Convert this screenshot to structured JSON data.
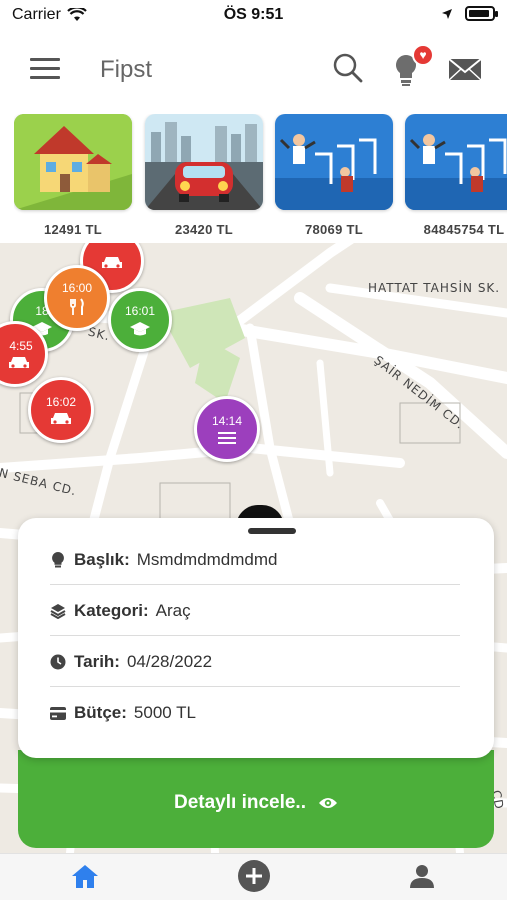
{
  "status": {
    "carrier": "Carrier",
    "time": "ÖS 9:51",
    "battery_level": 0.92
  },
  "header": {
    "title": "Fipst",
    "notification_badge": "♥"
  },
  "thumbnails": [
    {
      "icon": "house-illustration",
      "price": "12491 TL"
    },
    {
      "icon": "car-illustration",
      "price": "23420 TL"
    },
    {
      "icon": "hurdle-race-illustration",
      "price": "78069 TL"
    },
    {
      "icon": "hurdle-race-illustration",
      "price": "84845754 TL"
    }
  ],
  "map": {
    "streets": [
      "HATTAT TAHSİN SK.",
      "ŞAİR NEDİM CD.",
      "SK.",
      "N SEBA CD.",
      "CD"
    ],
    "markers": [
      {
        "time": "",
        "icon": "car-icon",
        "color": "#e53935"
      },
      {
        "time": "16:00",
        "icon": "fork-knife-icon",
        "color": "#ef7f2f"
      },
      {
        "time": "18",
        "icon": "graduation-cap-icon",
        "color": "#4caf3a"
      },
      {
        "time": "16:01",
        "icon": "graduation-cap-icon",
        "color": "#4caf3a"
      },
      {
        "time": "4:55",
        "icon": "car-icon",
        "color": "#e53935"
      },
      {
        "time": "16:02",
        "icon": "car-icon",
        "color": "#e53935"
      },
      {
        "time": "14:14",
        "icon": "list-icon",
        "color": "#9c3fbd"
      }
    ]
  },
  "detail": {
    "title_label": "Başlık:",
    "title_value": "Msmdmdmdmdmd",
    "category_label": "Kategori:",
    "category_value": "Araç",
    "date_label": "Tarih:",
    "date_value": "04/28/2022",
    "budget_label": "Bütçe:",
    "budget_value": "5000 TL",
    "button_label": "Detaylı incele.."
  },
  "tabs": [
    {
      "icon": "home-icon",
      "active": true
    },
    {
      "icon": "add-circle-icon",
      "active": false
    },
    {
      "icon": "profile-icon",
      "active": false
    }
  ],
  "colors": {
    "green": "#4caf3a",
    "red": "#e53935",
    "orange": "#ef7f2f",
    "purple": "#9c3fbd",
    "tab_active": "#2f80ed",
    "tab_inactive": "#555555"
  }
}
